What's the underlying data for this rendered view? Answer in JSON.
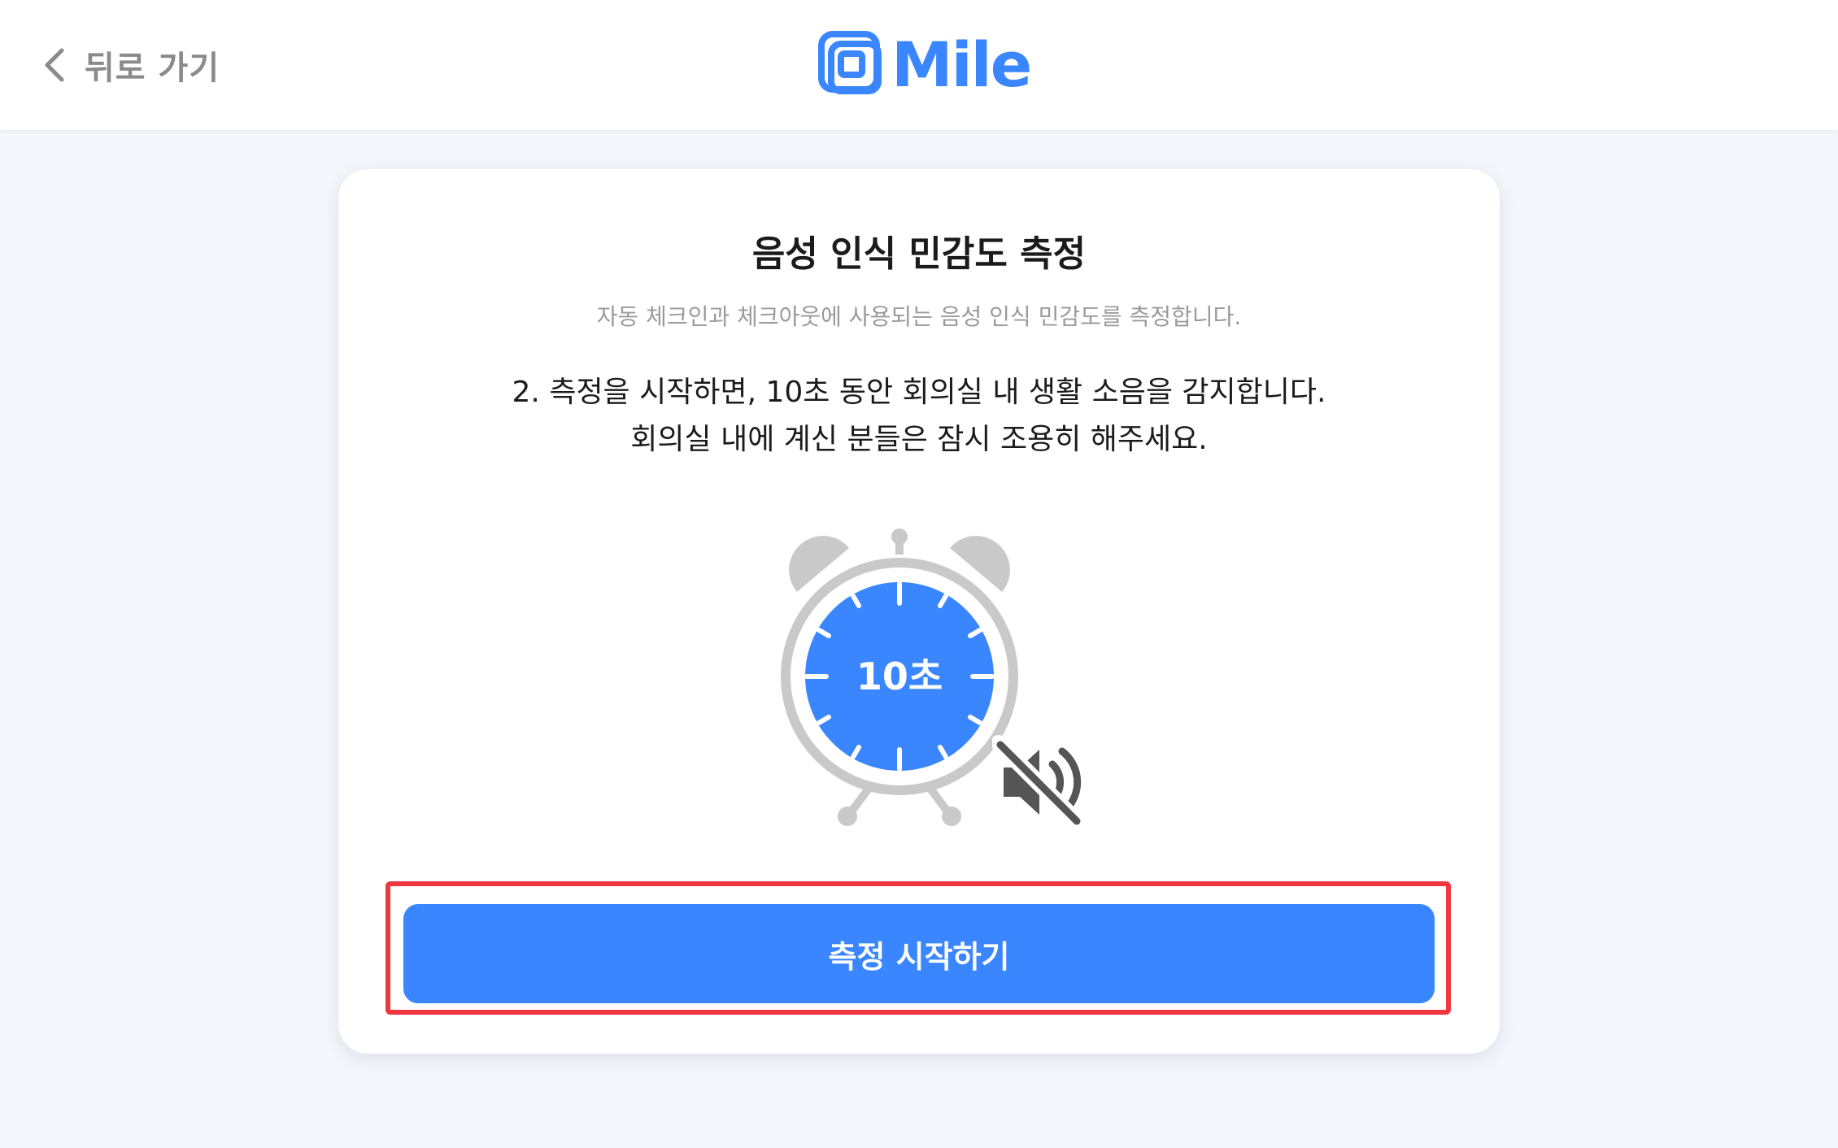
{
  "header": {
    "back_label": "뒤로 가기",
    "logo_text": "Mile",
    "brand_color": "#3a86ff"
  },
  "card": {
    "title": "음성 인식 민감도 측정",
    "subtitle": "자동 체크인과 체크아웃에 사용되는 음성 인식 민감도를 측정합니다.",
    "instruction_line1": "2. 측정을 시작하면, 10초 동안 회의실 내 생활 소음을 감지합니다.",
    "instruction_line2": "회의실 내에 계신 분들은 잠시 조용히 해주세요.",
    "clock_label": "10초",
    "clock_icon": "alarm-clock-icon",
    "mute_icon": "speaker-muted-icon",
    "start_button_label": "측정 시작하기",
    "highlight_color": "#f0363e"
  }
}
